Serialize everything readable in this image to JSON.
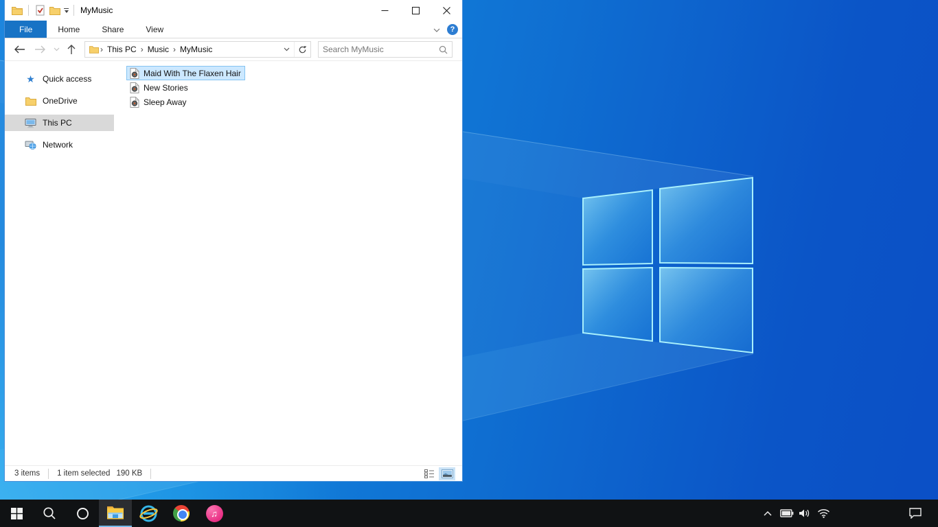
{
  "window": {
    "title": "MyMusic"
  },
  "ribbon": {
    "tabs": [
      "File",
      "Home",
      "Share",
      "View"
    ]
  },
  "address": {
    "breadcrumb": [
      "This PC",
      "Music",
      "MyMusic"
    ],
    "search_placeholder": "Search MyMusic"
  },
  "sidebar": {
    "items": [
      {
        "label": "Quick access"
      },
      {
        "label": "OneDrive"
      },
      {
        "label": "This PC",
        "selected": true
      },
      {
        "label": "Network"
      }
    ]
  },
  "files": [
    {
      "name": "Maid With The Flaxen Hair",
      "selected": true
    },
    {
      "name": "New Stories"
    },
    {
      "name": "Sleep Away"
    }
  ],
  "status": {
    "items_count": "3 items",
    "selection": "1 item selected",
    "selection_size": "190 KB"
  },
  "colors": {
    "accent": "#1873c5",
    "selection_bg": "#cce8ff",
    "selection_border": "#84c3f1",
    "taskbar_bg": "#101214",
    "wallpaper_bright": "#18a0ee",
    "wallpaper_deep": "#0b4fc6"
  }
}
